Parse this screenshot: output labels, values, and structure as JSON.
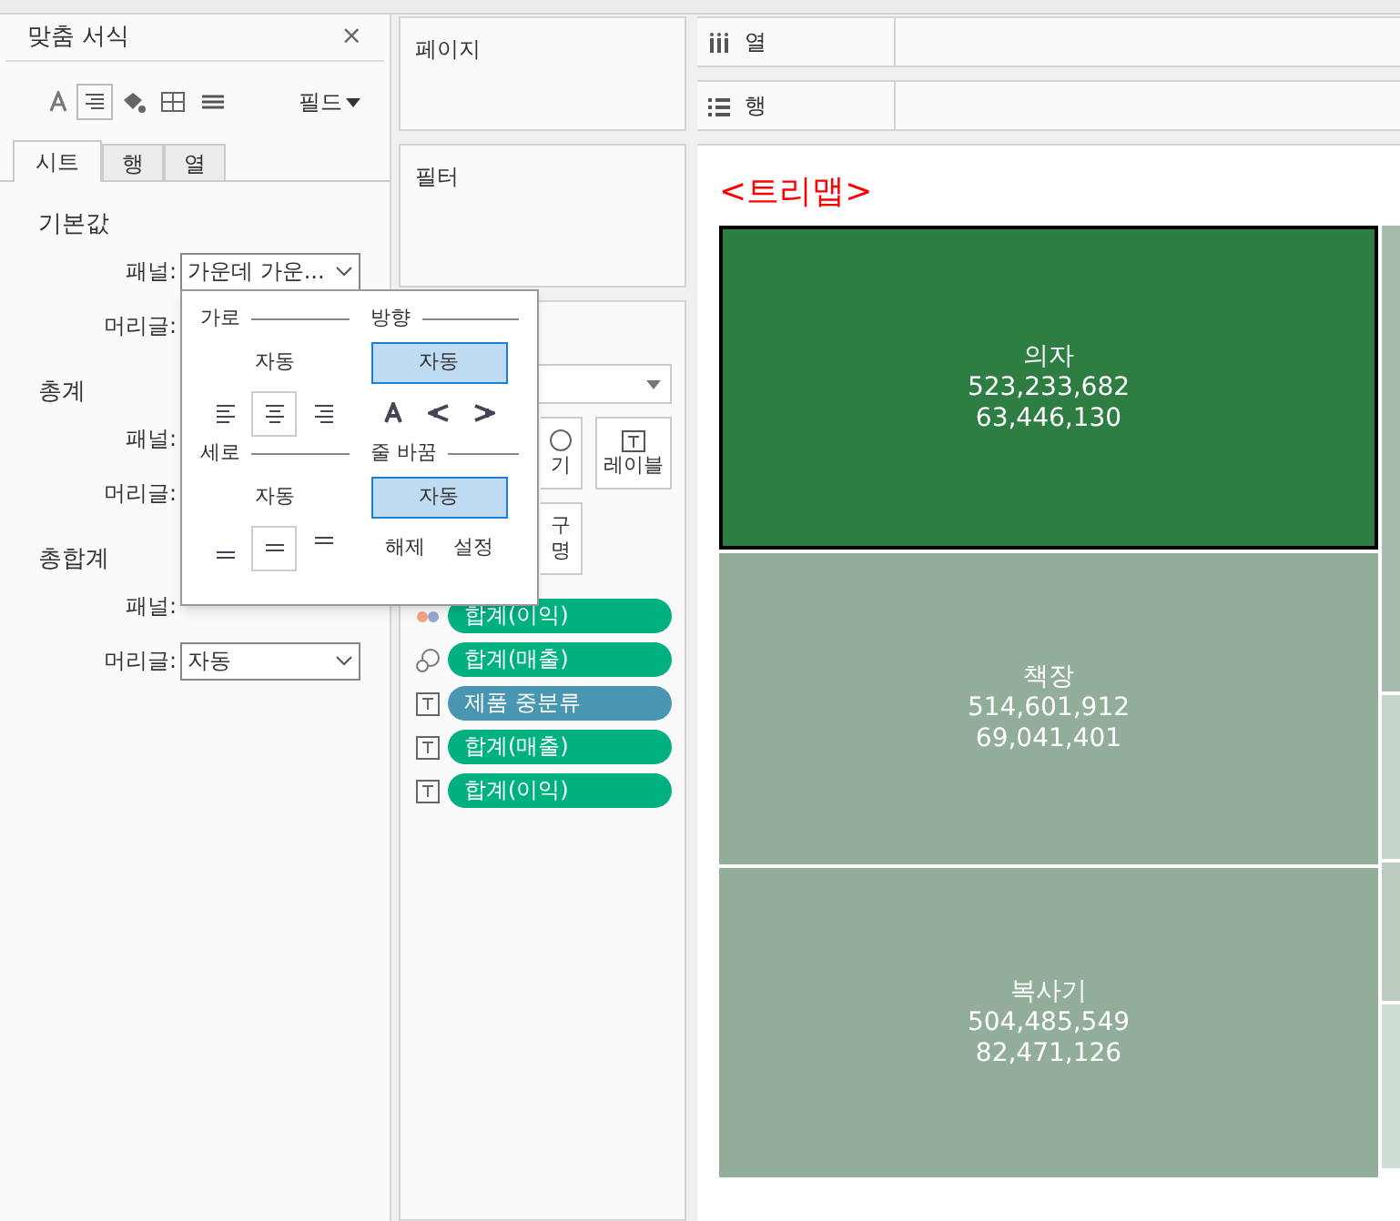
{
  "format_pane": {
    "title": "맞춤 서식",
    "close": "×",
    "field_menu": "필드",
    "tabs": [
      {
        "label": "시트",
        "selected": true
      },
      {
        "label": "행",
        "selected": false
      },
      {
        "label": "열",
        "selected": false
      }
    ],
    "sections": [
      {
        "title": "기본값",
        "rows": [
          {
            "label": "패널:",
            "value": "가운데 가운..."
          },
          {
            "label": "머리글:"
          }
        ]
      },
      {
        "title": "총계",
        "rows": [
          {
            "label": "패널:"
          },
          {
            "label": "머리글:"
          }
        ]
      },
      {
        "title": "총합계",
        "rows": [
          {
            "label": "패널:"
          },
          {
            "label": "머리글:",
            "value": "자동"
          }
        ]
      }
    ]
  },
  "alignment_popup": {
    "horizontal": {
      "title": "가로",
      "value": "자동",
      "options": [
        {
          "kind": "left",
          "selected": false
        },
        {
          "kind": "center",
          "selected": true
        },
        {
          "kind": "right",
          "selected": false
        }
      ]
    },
    "direction": {
      "title": "방향",
      "button": "자동",
      "selected": true
    },
    "vertical": {
      "title": "세로",
      "value": "자동",
      "options": [
        {
          "kind": "bottom",
          "selected": false
        },
        {
          "kind": "middle",
          "selected": true
        },
        {
          "kind": "top",
          "selected": false
        }
      ]
    },
    "wrap": {
      "title": "줄 바꿈",
      "button": "자동",
      "selected": true,
      "options": [
        "해제",
        "설정"
      ]
    }
  },
  "shelves": {
    "pages": "페이지",
    "filters": "필터",
    "columns": "열",
    "rows": "행"
  },
  "marks": {
    "buttons": [
      {
        "label": "기",
        "kind": "size"
      },
      {
        "label": "레이블",
        "kind": "label"
      },
      {
        "label": "구\n명",
        "kind": "tooltip"
      }
    ],
    "pills": [
      {
        "kind": "color",
        "label": "합계(이익)",
        "color": "#00b180"
      },
      {
        "kind": "size",
        "label": "합계(매출)",
        "color": "#00b180"
      },
      {
        "kind": "text",
        "label": "제품 중분류",
        "color": "#4996b2"
      },
      {
        "kind": "text",
        "label": "합계(매출)",
        "color": "#00b180"
      },
      {
        "kind": "text",
        "label": "합계(이익)",
        "color": "#00b180"
      }
    ]
  },
  "view": {
    "title": "<트리맵>",
    "tiles": [
      {
        "label": "의자",
        "values": [
          "523,233,682",
          "63,446,130"
        ],
        "selected": true,
        "color": "#2e7d43"
      },
      {
        "label": "책장",
        "values": [
          "514,601,912",
          "69,041,401"
        ],
        "selected": false,
        "color": "#93ad9b"
      },
      {
        "label": "복사기",
        "values": [
          "504,485,549",
          "82,471,126"
        ],
        "selected": false,
        "color": "#93ad9b"
      },
      {
        "selected": false,
        "color": "#a7bcad"
      },
      {
        "selected": false,
        "color": "#c6d5ca"
      },
      {
        "selected": false,
        "color": "#bccdc0"
      },
      {
        "selected": false,
        "color": "#d0ddd3"
      }
    ]
  }
}
